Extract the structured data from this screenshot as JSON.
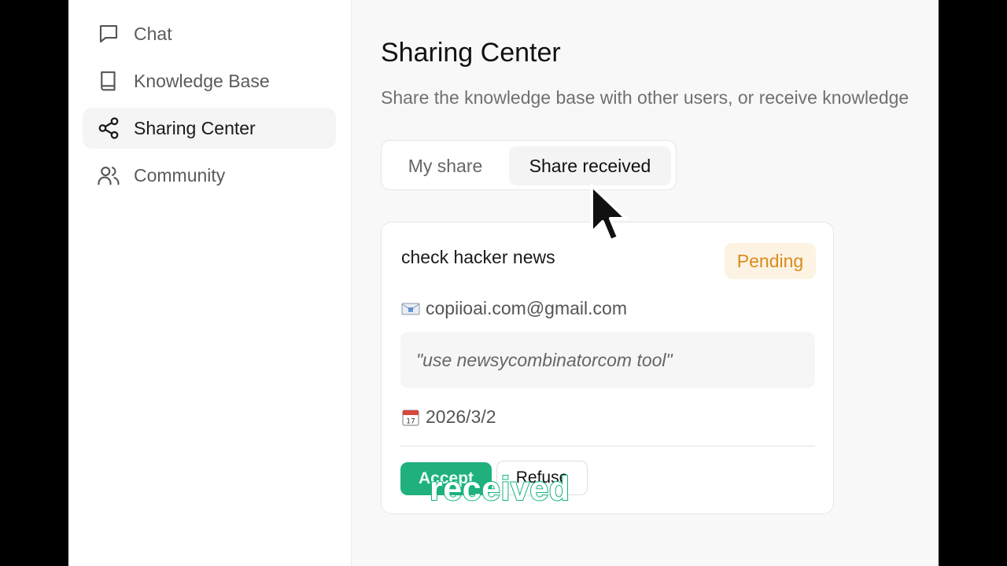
{
  "sidebar": {
    "items": [
      {
        "label": "Chat",
        "icon": "chat-icon",
        "active": false
      },
      {
        "label": "Knowledge Base",
        "icon": "book-icon",
        "active": false
      },
      {
        "label": "Sharing Center",
        "icon": "share-icon",
        "active": true
      },
      {
        "label": "Community",
        "icon": "users-icon",
        "active": false
      }
    ]
  },
  "main": {
    "title": "Sharing Center",
    "subtitle": "Share the knowledge base with other users, or receive knowledge",
    "tabs": [
      {
        "label": "My share",
        "selected": false
      },
      {
        "label": "Share received",
        "selected": true
      }
    ],
    "card": {
      "title": "check hacker news",
      "status": "Pending",
      "email_icon": "envelope-icon",
      "email": "copiioai.com@gmail.com",
      "message": "\"use newsycombinatorcom tool\"",
      "date_icon": "calendar-icon",
      "date": "2026/3/2",
      "accept_label": "Accept",
      "refuse_label": "Refuse"
    }
  },
  "overlay": {
    "caption": "received"
  },
  "colors": {
    "accent_green": "#20b07c",
    "pending_text": "#d98b1d",
    "pending_bg": "#fdf3e3"
  }
}
